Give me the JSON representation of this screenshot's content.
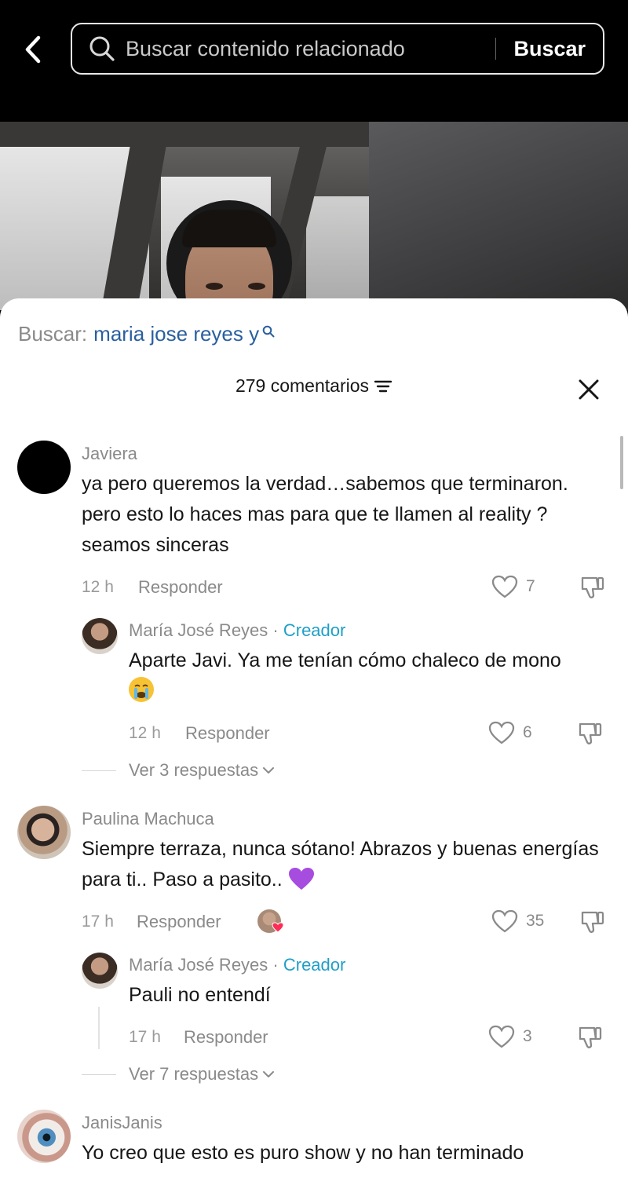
{
  "search": {
    "placeholder": "Buscar contenido relacionado",
    "button_label": "Buscar"
  },
  "suggested_search": {
    "label": "Buscar:",
    "query": "maria jose reyes y"
  },
  "comments_header": {
    "count_label": "279 comentarios"
  },
  "comments": [
    {
      "username": "Javiera",
      "text": "ya pero queremos la verdad…sabemos que terminaron. pero esto lo haces mas para que te llamen al reality ? seamos sinceras",
      "time": "12 h",
      "reply_label": "Responder",
      "likes": "7",
      "reply": {
        "username": "María José Reyes",
        "separator": " · ",
        "badge": "Creador",
        "text": "Aparte Javi. Ya me tenían cómo chaleco de mono",
        "emoji": "crying-face",
        "time": "12 h",
        "reply_label": "Responder",
        "likes": "6"
      },
      "view_replies": "Ver 3 respuestas"
    },
    {
      "username": "Paulina Machuca",
      "text": "Siempre terraza, nunca sótano! Abrazos y buenas energías para ti.. Paso a pasito..",
      "emoji": "purple-heart",
      "time": "17 h",
      "reply_label": "Responder",
      "likes": "35",
      "reply": {
        "username": "María José Reyes",
        "separator": " · ",
        "badge": "Creador",
        "text": "Pauli no entendí",
        "time": "17 h",
        "reply_label": "Responder",
        "likes": "3"
      },
      "view_replies": "Ver 7 respuestas"
    },
    {
      "username": "JanisJanis",
      "text": "Yo creo que esto es puro show y no han terminado"
    }
  ],
  "colors": {
    "creator_badge": "#1f9fc7",
    "suggested_query": "#2a5f9e"
  }
}
